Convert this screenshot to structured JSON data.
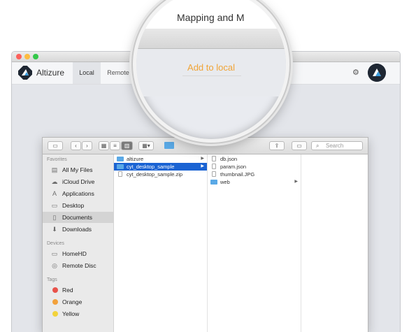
{
  "app": {
    "window_title": "Altizure",
    "name": "Altizure",
    "tabs": [
      {
        "label": "Local"
      },
      {
        "label": "Remote"
      }
    ],
    "settings_icon": "gear-icon",
    "accent_color": "#f0a437"
  },
  "magnifier": {
    "partial_text": "Mapping and M",
    "action_label": "Add to local"
  },
  "finder": {
    "search_placeholder": "Search",
    "path_label": "",
    "sidebar": {
      "favorites_heading": "Favorites",
      "favorites": [
        {
          "label": "All My Files",
          "icon": "all-files-icon"
        },
        {
          "label": "iCloud Drive",
          "icon": "cloud-icon"
        },
        {
          "label": "Applications",
          "icon": "applications-icon"
        },
        {
          "label": "Desktop",
          "icon": "desktop-icon"
        },
        {
          "label": "Documents",
          "icon": "documents-icon",
          "selected": true
        },
        {
          "label": "Downloads",
          "icon": "downloads-icon"
        }
      ],
      "devices_heading": "Devices",
      "devices": [
        {
          "label": "HomeHD",
          "icon": "disk-icon"
        },
        {
          "label": "Remote Disc",
          "icon": "disc-icon"
        }
      ],
      "tags_heading": "Tags",
      "tags": [
        {
          "label": "Red",
          "color": "#e8524a"
        },
        {
          "label": "Orange",
          "color": "#f2a13b"
        },
        {
          "label": "Yellow",
          "color": "#f2d33b"
        }
      ]
    },
    "column1": [
      {
        "label": "altizure",
        "kind": "folder"
      },
      {
        "label": "cyt_desktop_sample",
        "kind": "folder",
        "selected": true
      },
      {
        "label": "cyt_desktop_sample.zip",
        "kind": "file"
      }
    ],
    "column2": [
      {
        "label": "db.json",
        "kind": "file"
      },
      {
        "label": "param.json",
        "kind": "file"
      },
      {
        "label": "thumbnail.JPG",
        "kind": "file"
      },
      {
        "label": "web",
        "kind": "folder"
      }
    ]
  }
}
